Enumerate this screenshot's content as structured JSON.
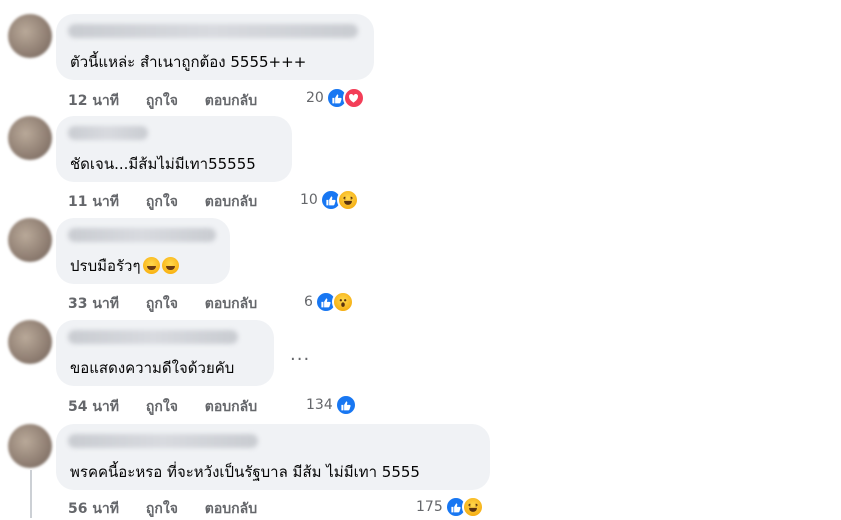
{
  "comments": [
    {
      "text": "ตัวนี้แหล่ะ สำเนาถูกต้อง 5555+++",
      "time": "12 นาที",
      "like_label": "ถูกใจ",
      "reply_label": "ตอบกลับ",
      "reaction_count": "20",
      "reactions": [
        "like-icon",
        "love-icon"
      ],
      "emoji_suffix": false
    },
    {
      "text": "ชัดเจน...มีส้มไม่มีเทา55555",
      "time": "11 นาที",
      "like_label": "ถูกใจ",
      "reply_label": "ตอบกลับ",
      "reaction_count": "10",
      "reactions": [
        "like-icon",
        "haha-icon"
      ],
      "emoji_suffix": false
    },
    {
      "text": "ปรบมือรัวๆ",
      "time": "33 นาที",
      "like_label": "ถูกใจ",
      "reply_label": "ตอบกลับ",
      "reaction_count": "6",
      "reactions": [
        "like-icon",
        "wow-icon"
      ],
      "emoji_suffix": true
    },
    {
      "text": "ขอแสดงความดีใจด้วยคับ",
      "time": "54 นาที",
      "like_label": "ถูกใจ",
      "reply_label": "ตอบกลับ",
      "reaction_count": "134",
      "reactions": [
        "like-icon"
      ],
      "emoji_suffix": false,
      "more_label": "..."
    },
    {
      "text": "พรคคนี้อะหรอ ที่จะหวังเป็นรัฐบาล มีส้ม ไม่มีเทา 5555",
      "time": "56 นาที",
      "like_label": "ถูกใจ",
      "reply_label": "ตอบกลับ",
      "reaction_count": "175",
      "reactions": [
        "like-icon",
        "haha-icon"
      ],
      "emoji_suffix": false
    }
  ],
  "colors": {
    "bubble": "#f0f2f5",
    "meta_text": "#65676b",
    "like_blue": "#1877f2",
    "love_red": "#f33e58"
  }
}
